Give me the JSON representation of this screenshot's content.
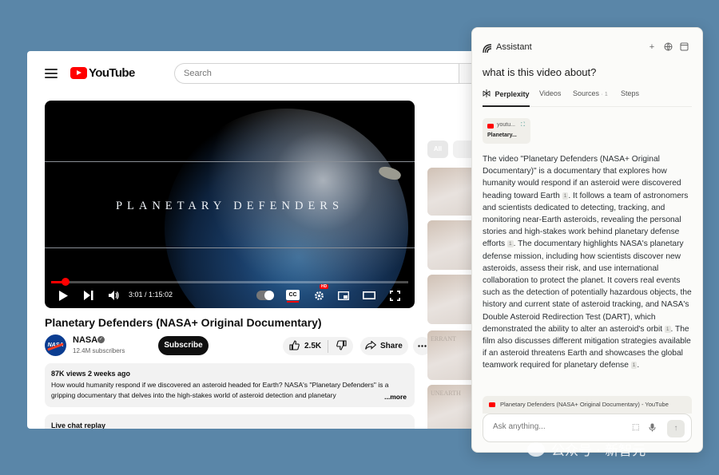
{
  "youtube": {
    "logo_text": "YouTube",
    "search": {
      "placeholder": "Search"
    },
    "player": {
      "overlay_title": "PLANETARY  DEFENDERS",
      "current_time": "3:01",
      "duration": "1:15:02",
      "time_display": "3:01 / 1:15:02",
      "progress_fraction": 0.04,
      "cc_label": "CC",
      "hd_badge": "HD"
    },
    "video_title": "Planetary Defenders (NASA+ Original Documentary)",
    "channel": {
      "name": "NASA",
      "logo_text": "NASA",
      "subscribers": "12.4M subscribers",
      "subscribe_label": "Subscribe"
    },
    "actions": {
      "likes": "2.5K",
      "share_label": "Share"
    },
    "description": {
      "meta": "87K views  2 weeks ago",
      "text": "How would humanity respond if we discovered an asteroid headed for Earth? NASA's \"Planetary Defenders\" is a gripping documentary that delves into the high-stakes world of asteroid detection and planetary",
      "more_label": "...more"
    },
    "live_chat_label": "Live chat replay",
    "sidebar": {
      "chips": [
        "All",
        ""
      ],
      "thumb_labels": [
        "",
        "",
        "",
        "",
        "ERRANT",
        "UNEARTH"
      ]
    }
  },
  "assistant": {
    "title": "Assistant",
    "question": "what is this video about?",
    "tabs": [
      {
        "label": "Perplexity",
        "active": true
      },
      {
        "label": "Videos"
      },
      {
        "label": "Sources",
        "count": "· 1"
      },
      {
        "label": "Steps"
      }
    ],
    "source_card": {
      "site": "youtu...",
      "title": "Planetary..."
    },
    "answer_segments": [
      "The video \"Planetary Defenders (NASA+ Original Documentary)\" is a documentary that explores how humanity would respond if an asteroid were discovered heading toward Earth",
      ". It follows a team of astronomers and scientists dedicated to detecting, tracking, and monitoring near-Earth asteroids, revealing the personal stories and high-stakes work behind planetary defense efforts",
      ". The documentary highlights NASA's planetary defense mission, including how scientists discover new asteroids, assess their risk, and use international collaboration to protect the planet. It covers real events such as the detection of potentially hazardous objects, the history and current state of asteroid tracking, and NASA's Double Asteroid Redirection Test (DART), which demonstrated the ability to alter an asteroid's orbit",
      ". The film also discusses different mitigation strategies available if an asteroid threatens Earth and showcases the global teamwork required for planetary defense",
      "."
    ],
    "citation_marker": "1",
    "reference": "Planetary Defenders (NASA+ Original Documentary) - YouTube",
    "ask_placeholder": "Ask anything..."
  },
  "watermark": "公众号 · 新智元",
  "colors": {
    "youtube_red": "#ff0000",
    "background": "#5a86a8",
    "perplexity_teal": "#2a8a83"
  }
}
